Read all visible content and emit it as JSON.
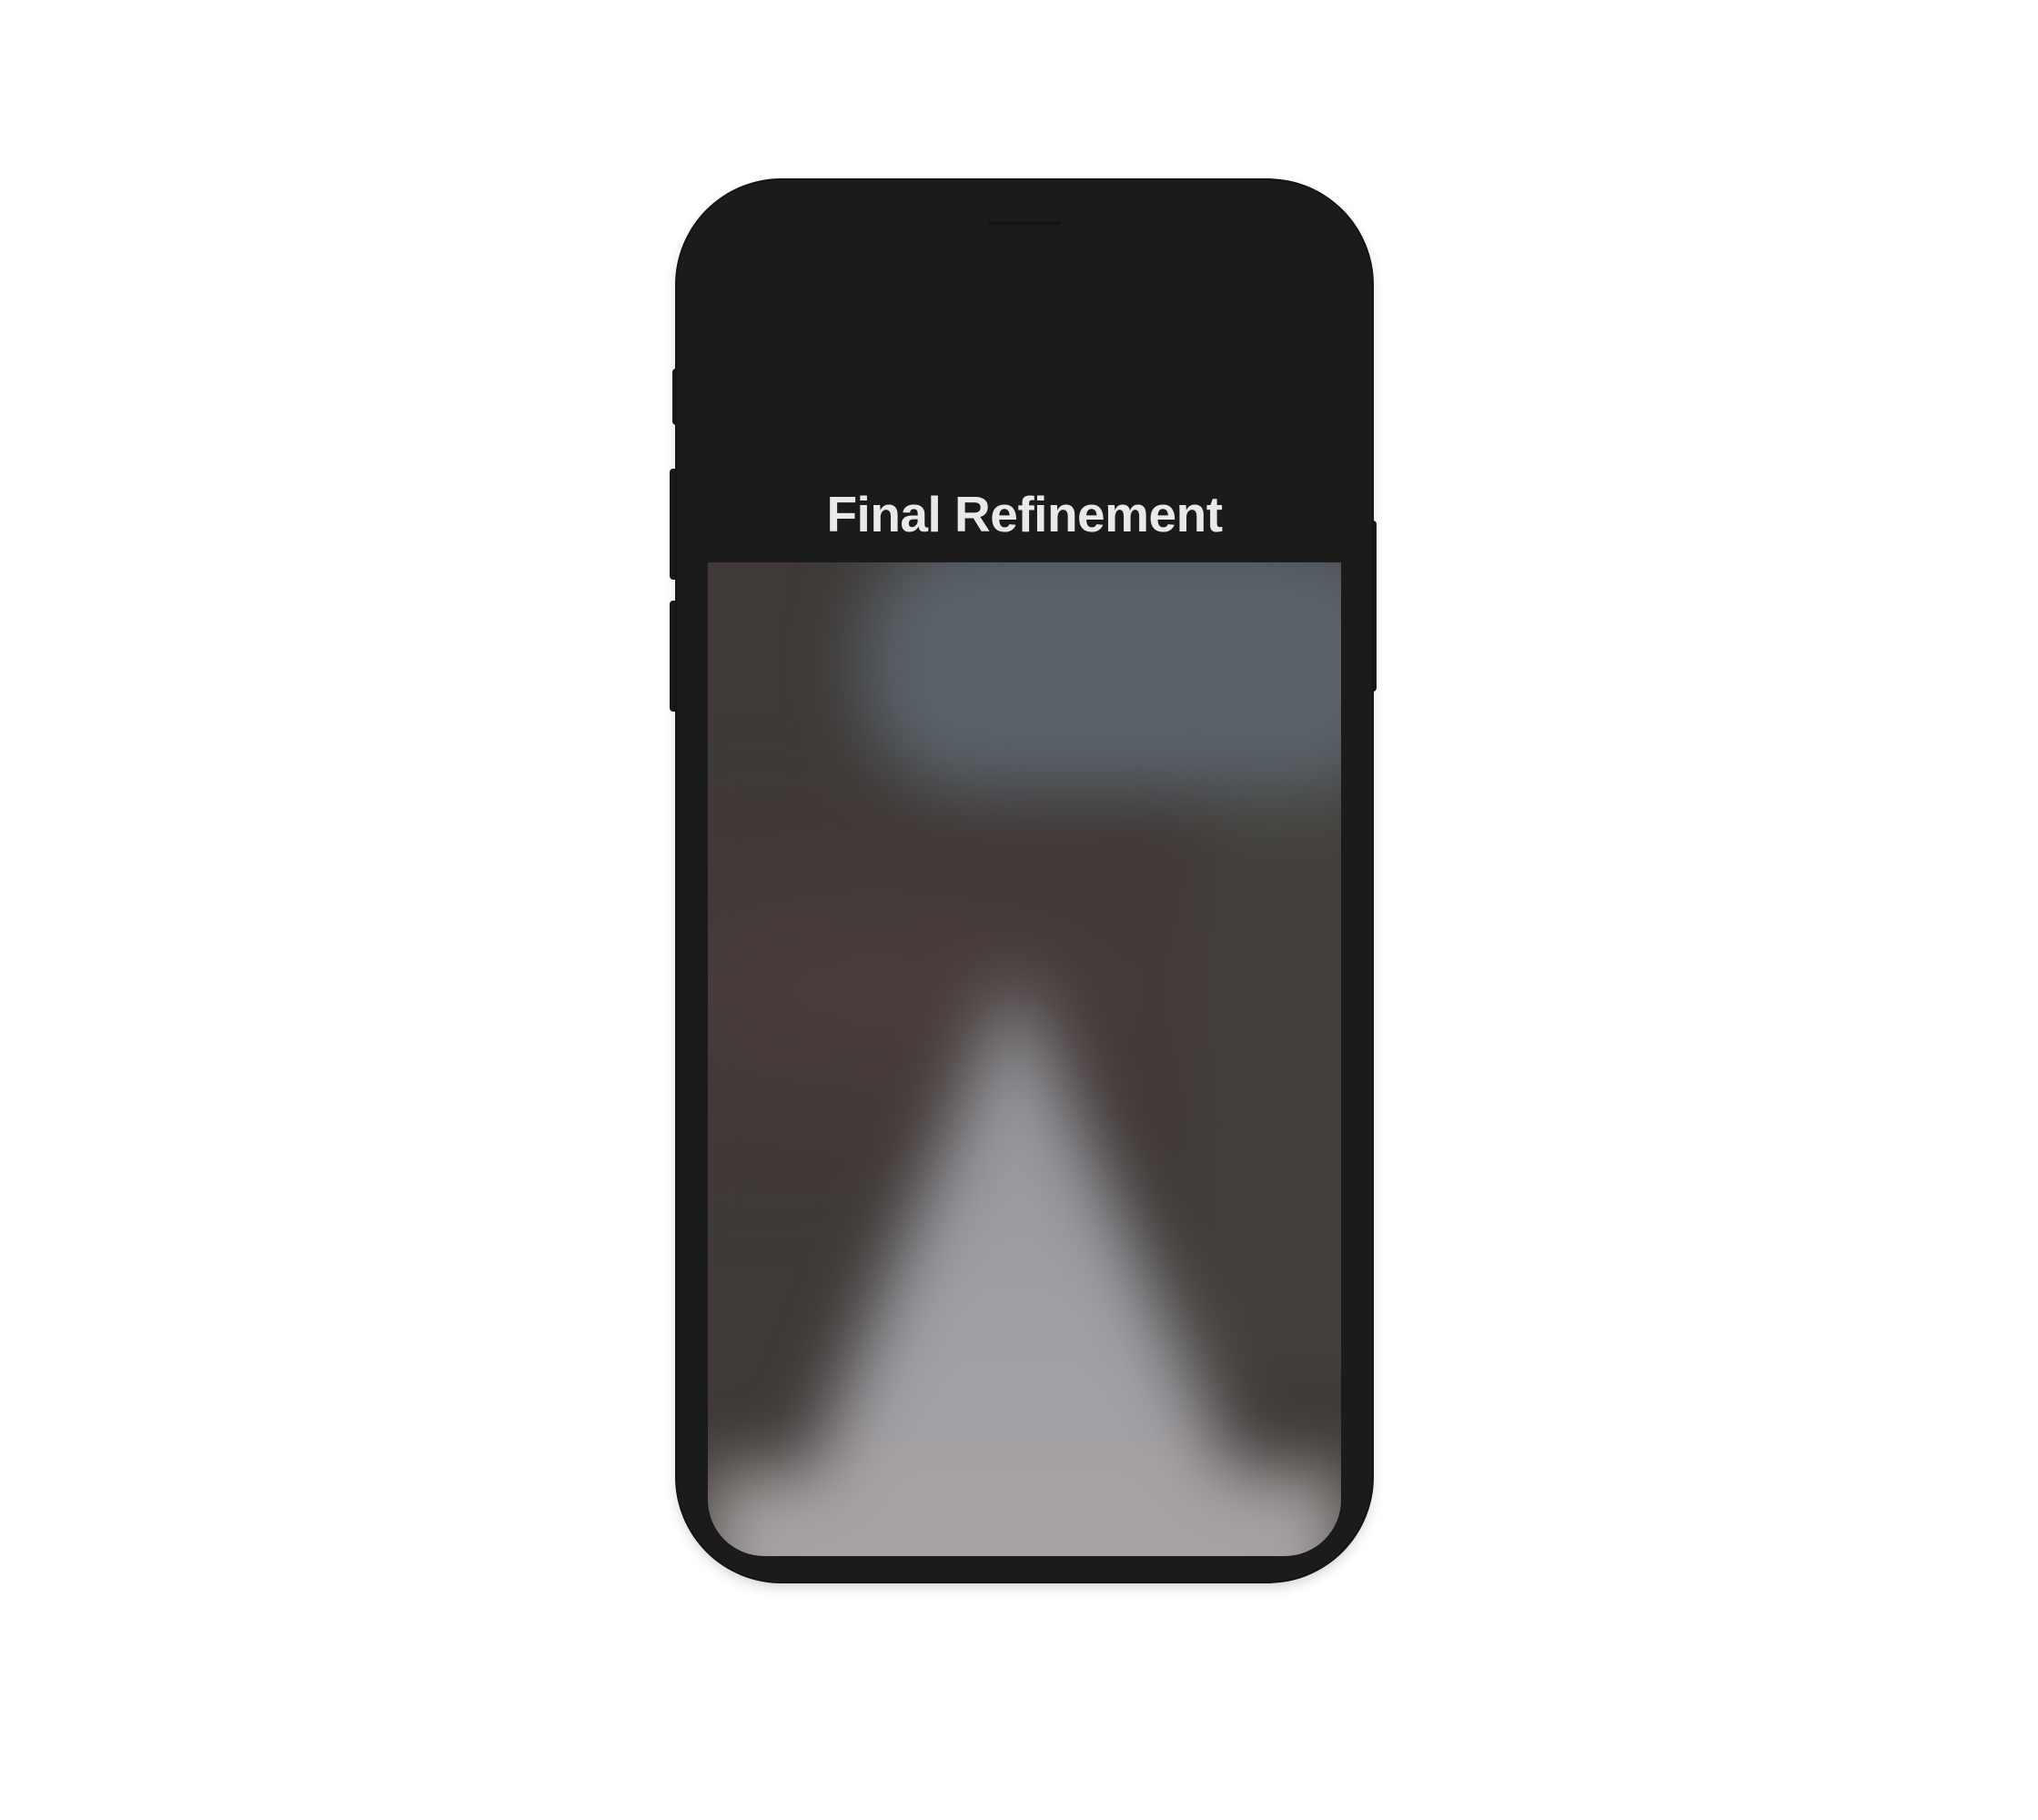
{
  "screen": {
    "title": "Final Refinement"
  },
  "colors": {
    "background": "#ffffff",
    "phone_body": "#1b1b1b",
    "title_text": "#e9e9e9"
  },
  "photo": {
    "description_type": "blurred-photo"
  }
}
